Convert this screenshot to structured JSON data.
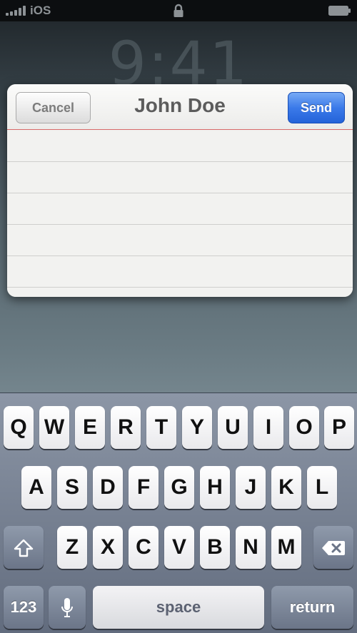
{
  "status_bar": {
    "carrier": "iOS",
    "icons": [
      "signal-icon",
      "lock-icon",
      "battery-icon"
    ]
  },
  "lock_screen": {
    "time": "9:41"
  },
  "compose": {
    "title": "John Doe",
    "cancel_label": "Cancel",
    "send_label": "Send"
  },
  "keyboard": {
    "row1": [
      "Q",
      "W",
      "E",
      "R",
      "T",
      "Y",
      "U",
      "I",
      "O",
      "P"
    ],
    "row2": [
      "A",
      "S",
      "D",
      "F",
      "G",
      "H",
      "J",
      "K",
      "L"
    ],
    "row3": [
      "Z",
      "X",
      "C",
      "V",
      "B",
      "N",
      "M"
    ],
    "numbers_label": "123",
    "space_label": "space",
    "return_label": "return",
    "icons": [
      "shift-icon",
      "delete-icon",
      "microphone-icon"
    ]
  },
  "colors": {
    "send_blue": "#2f6fe4",
    "divider_red": "#d86a6a",
    "keyboard_bg": "#737d8f"
  }
}
